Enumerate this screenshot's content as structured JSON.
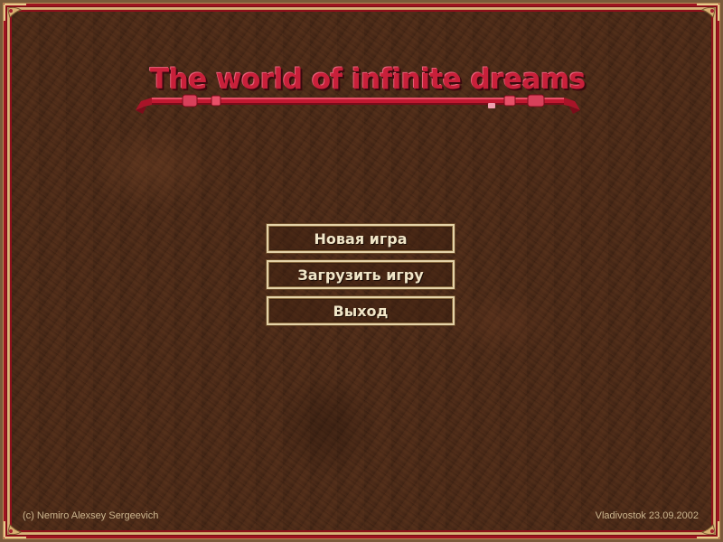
{
  "title": "The world of infinite dreams",
  "menu": {
    "new_game": "Новая игра",
    "load_game": "Загрузить игру",
    "exit": "Выход"
  },
  "footer": {
    "author": "(c) Nemiro Alexsey Sergeevich",
    "place_date": "Vladivostok 23.09.2002"
  },
  "colors": {
    "title_red": "#c8203a",
    "frame_red": "#9e1420",
    "frame_gold": "#c89a62",
    "leather": "#4a2a18",
    "button_border": "#e4d2a8",
    "button_text": "#f1e6c8",
    "credit_text": "#cbb58e"
  },
  "icons": {
    "corners": "ornament-corner-icon",
    "ribbon": "ribbon-banner-icon"
  }
}
